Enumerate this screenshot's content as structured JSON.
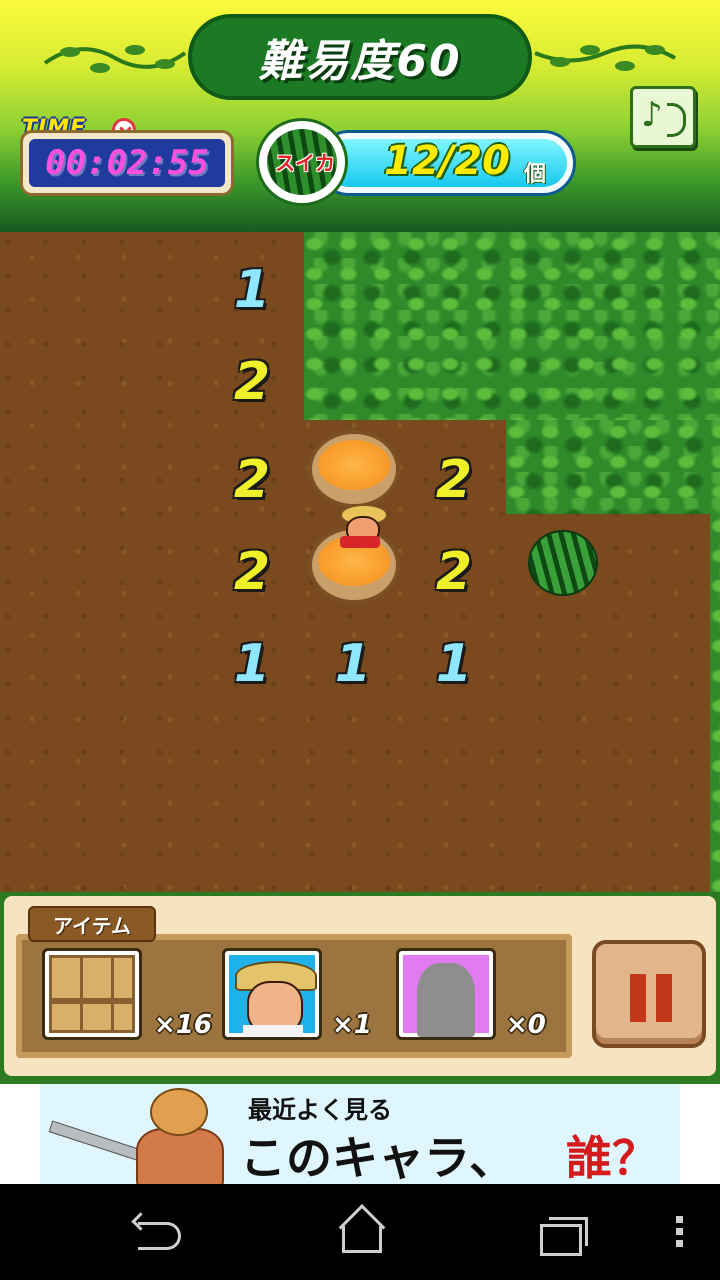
{
  "header": {
    "title": "難易度60",
    "time_label": "TIME",
    "time_value": "00:02:55",
    "watermelon_badge": "スイカ",
    "watermelon_count": "12/20",
    "watermelon_unit": "個",
    "sound_icon": "music-note-speaker-icon"
  },
  "field": {
    "cells": [
      {
        "value": "1",
        "color": "blue"
      },
      {
        "value": "2",
        "color": "yellow"
      },
      {
        "value": "2",
        "color": "yellow"
      },
      {
        "value": "2",
        "color": "yellow"
      },
      {
        "value": "2",
        "color": "yellow"
      },
      {
        "value": "2",
        "color": "yellow"
      },
      {
        "value": "1",
        "color": "blue"
      },
      {
        "value": "1",
        "color": "blue"
      },
      {
        "value": "1",
        "color": "blue"
      }
    ]
  },
  "items": {
    "tab_label": "アイテム",
    "slots": [
      {
        "icon": "wooden-crate-icon",
        "count": "×16"
      },
      {
        "icon": "farmer-portrait-icon",
        "count": "×1"
      },
      {
        "icon": "locked-silhouette-icon",
        "count": "×0"
      }
    ],
    "pause_icon": "pause-icon"
  },
  "ad": {
    "line1": "最近よく見る",
    "line2": "このキャラ、",
    "highlight": "誰？"
  },
  "colors": {
    "number_blue": "#8fe6ff",
    "number_yellow": "#f0f02a",
    "time_text": "#ff4fe0",
    "counter_text": "#ffeb00"
  }
}
